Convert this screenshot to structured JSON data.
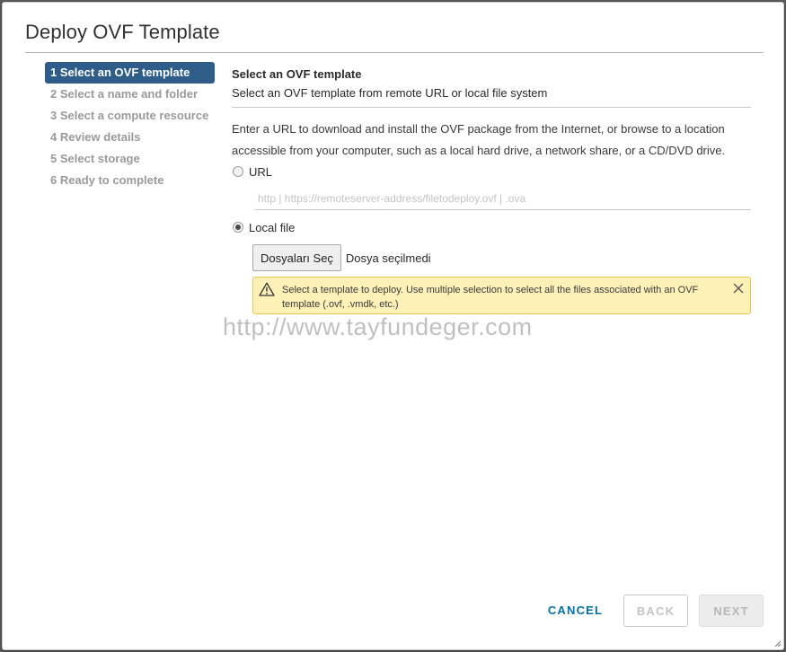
{
  "dialog": {
    "title": "Deploy OVF Template"
  },
  "steps": [
    {
      "label": "1 Select an OVF template",
      "active": true
    },
    {
      "label": "2 Select a name and folder",
      "active": false
    },
    {
      "label": "3 Select a compute resource",
      "active": false
    },
    {
      "label": "4 Review details",
      "active": false
    },
    {
      "label": "5 Select storage",
      "active": false
    },
    {
      "label": "6 Ready to complete",
      "active": false
    }
  ],
  "main": {
    "title": "Select an OVF template",
    "subtitle": "Select an OVF template from remote URL or local file system",
    "description": "Enter a URL to download and install the OVF package from the Internet, or browse to a location accessible from your computer, such as a local hard drive, a network share, or a CD/DVD drive.",
    "url_option": {
      "label": "URL",
      "checked": false,
      "placeholder": "http | https://remoteserver-address/filetodeploy.ovf | .ova",
      "value": ""
    },
    "local_option": {
      "label": "Local file",
      "checked": true,
      "choose_button": "Dosyaları Seç",
      "status": "Dosya seçilmedi"
    },
    "warning": {
      "text": "Select a template to deploy. Use multiple selection to select all the files associated with an OVF template (.ovf, .vmdk, etc.)",
      "icon": "warning-triangle-icon",
      "close_icon": "close-icon",
      "background": "#fdf1b8",
      "border": "#e8c74a"
    }
  },
  "watermark": "http://www.tayfundeger.com",
  "footer": {
    "cancel": "CANCEL",
    "back": "BACK",
    "next": "NEXT"
  },
  "colors": {
    "accent": "#2f5d8a",
    "link": "#0072a3"
  }
}
